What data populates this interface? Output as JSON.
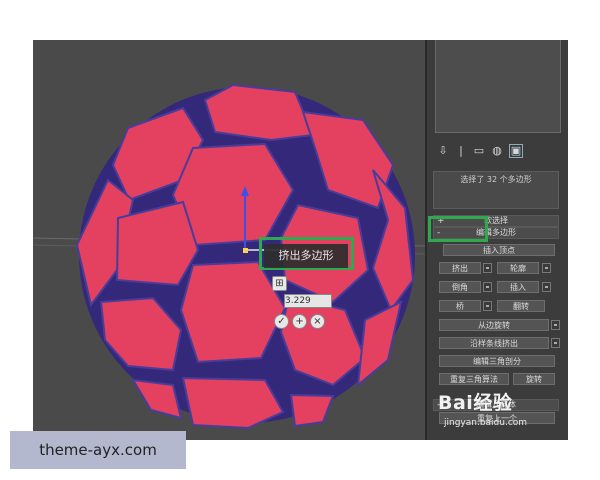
{
  "viewport": {
    "tooltip": "挤出多边形",
    "caddy_value": "3.229",
    "caddy_icons": [
      "grid-icon",
      "check-icon",
      "plus-icon",
      "close-icon"
    ]
  },
  "panel": {
    "toolbar_icons": [
      "hierarchy-icon",
      "motion-icon",
      "display-icon",
      "utilities-icon",
      "modify-icon"
    ],
    "selection_status": "选择了 32 个多边形",
    "rollouts": {
      "soft_selection": "软选择",
      "edit_polygons": "编辑多边形",
      "edit_geometry": "编辑几何体"
    },
    "buttons": {
      "insert_vertex": "插入顶点",
      "extrude": "挤出",
      "outline": "轮廓",
      "bevel": "倒角",
      "inset": "插入",
      "bridge": "桥",
      "flip": "翻转",
      "hinge_from_edge": "从边旋转",
      "extrude_along_spline": "沿样条线挤出",
      "edit_triangulation": "编辑三角剖分",
      "retriangulate": "重复三角算法",
      "turn": "旋转",
      "repeat_last": "重复上一个"
    },
    "collapse_sign": "-",
    "expand_sign": "+"
  },
  "watermark": {
    "brand": "Bai经验",
    "url": "jingyan.baidu.com"
  },
  "caption": "theme-ayx.com",
  "colors": {
    "face": "#e4405f",
    "edge": "#3a2f8a",
    "panel": "#3c3c3c",
    "highlight": "#2fa84f",
    "caption_bg": "#b4b8cf"
  }
}
